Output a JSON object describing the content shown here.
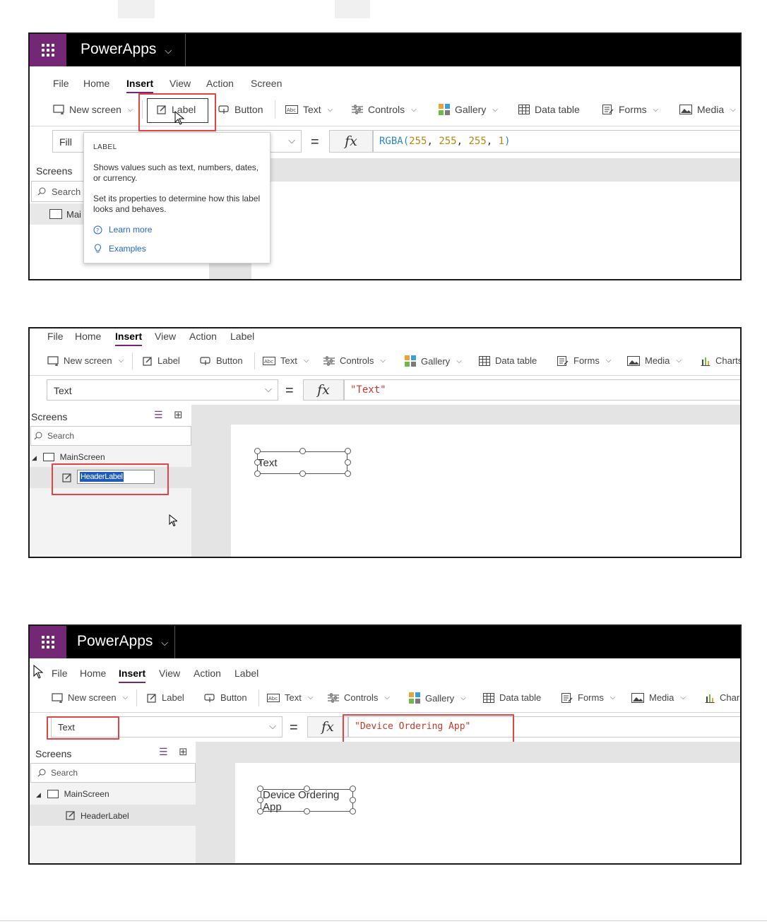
{
  "app": {
    "title": "PowerApps"
  },
  "panel1": {
    "menu": [
      "File",
      "Home",
      "Insert",
      "View",
      "Action",
      "Screen"
    ],
    "toolbar": {
      "new_screen": "New screen",
      "label": "Label",
      "button": "Button",
      "text": "Text",
      "controls": "Controls",
      "gallery": "Gallery",
      "data_table": "Data table",
      "forms": "Forms",
      "media": "Media"
    },
    "property": "Fill",
    "formula_fn": "RGBA(",
    "formula_args": [
      "255",
      "255",
      "255",
      "1"
    ],
    "formula_close": ")",
    "screens_header": "Screens",
    "search_placeholder": "Search",
    "screen_item": "Mai",
    "tooltip": {
      "heading": "LABEL",
      "para1": "Shows values such as text, numbers, dates, or currency.",
      "para2": "Set its properties to determine how this label looks and behaves.",
      "learn_more": "Learn more",
      "examples": "Examples"
    }
  },
  "panel2": {
    "menu": [
      "File",
      "Home",
      "Insert",
      "View",
      "Action",
      "Label"
    ],
    "toolbar": {
      "new_screen": "New screen",
      "label": "Label",
      "button": "Button",
      "text": "Text",
      "controls": "Controls",
      "gallery": "Gallery",
      "data_table": "Data table",
      "forms": "Forms",
      "media": "Media",
      "charts": "Charts"
    },
    "property": "Text",
    "formula": "\"Text\"",
    "screens_header": "Screens",
    "search_placeholder": "Search",
    "tree_screen": "MainScreen",
    "tree_label_edit": "HeaderLabel",
    "canvas_label": "Text"
  },
  "panel3": {
    "menu": [
      "File",
      "Home",
      "Insert",
      "View",
      "Action",
      "Label"
    ],
    "toolbar": {
      "new_screen": "New screen",
      "label": "Label",
      "button": "Button",
      "text": "Text",
      "controls": "Controls",
      "gallery": "Gallery",
      "data_table": "Data table",
      "forms": "Forms",
      "media": "Media",
      "charts": "Char"
    },
    "property": "Text",
    "formula": "\"Device Ordering App\"",
    "screens_header": "Screens",
    "search_placeholder": "Search",
    "tree_screen": "MainScreen",
    "tree_label": "HeaderLabel",
    "canvas_label_line1": "Device Ordering",
    "canvas_label_line2": "App"
  },
  "colors": {
    "brand_purple": "#742774",
    "highlight_red": "#e04444",
    "formula_string_red": "#c0392b",
    "formula_fn_blue": "#2a8ab5",
    "formula_number_gold": "#b8860b",
    "link_blue": "#2266cc"
  },
  "icons": [
    "waffle-icon",
    "chevron-down-icon",
    "new-screen-icon",
    "label-icon",
    "button-icon",
    "text-icon",
    "controls-icon",
    "gallery-icon",
    "data-table-icon",
    "forms-icon",
    "media-icon",
    "charts-icon",
    "search-icon",
    "screen-icon",
    "tree-view-icon",
    "thumbnail-view-icon",
    "help-icon",
    "lightbulb-icon",
    "cursor-icon"
  ]
}
